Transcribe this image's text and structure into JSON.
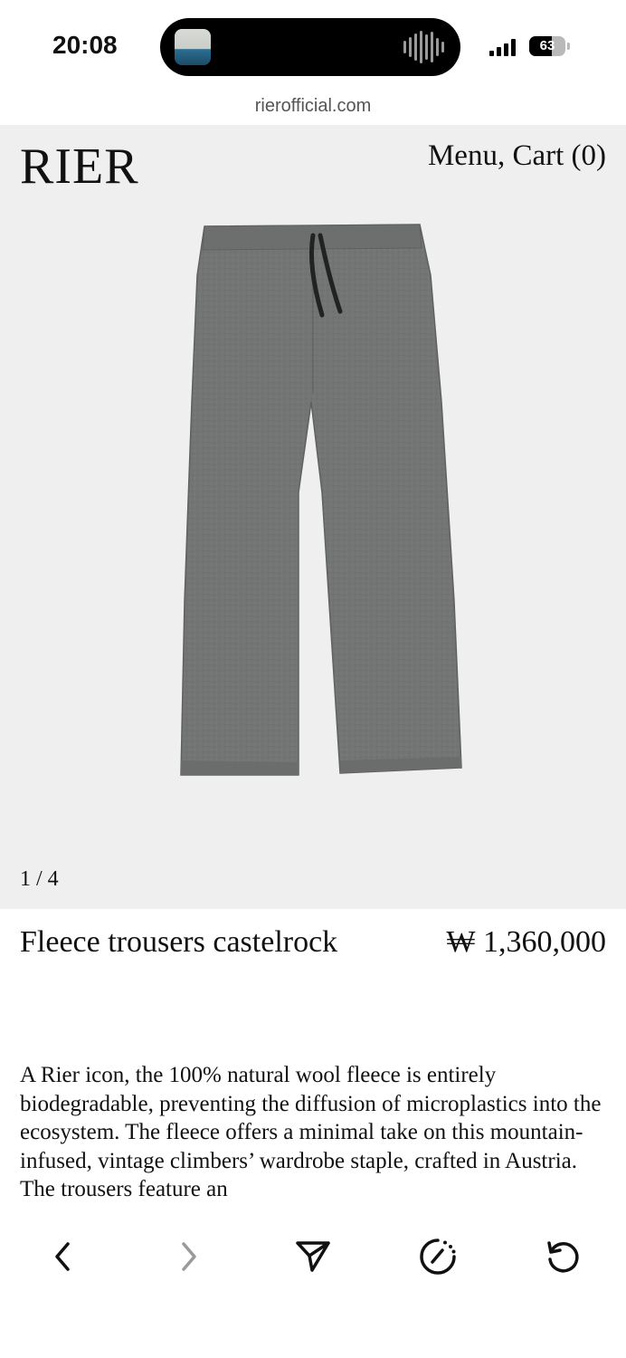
{
  "status_bar": {
    "time": "20:08",
    "battery_level": 63,
    "battery_text": "63",
    "signal_bars": 4
  },
  "browser": {
    "url": "rierofficial.com"
  },
  "site": {
    "logo": "RIER",
    "menu_cart": "Menu, Cart (0)"
  },
  "gallery": {
    "counter": "1 / 4",
    "image_icon": "grey-fleece-trousers-image"
  },
  "product": {
    "title": "Fleece trousers castelrock",
    "price": "₩ 1,360,000",
    "description": "A Rier icon, the 100% natural wool fleece is entirely biodegradable, preventing the diffusion of microplastics into the ecosystem. The fleece offers a minimal take on this mountain-infused, vintage climbers’ wardrobe staple, crafted in Austria. The trousers feature an"
  },
  "toolbar": {
    "icons": [
      "back-icon",
      "forward-icon",
      "share-icon",
      "speed-dial-icon",
      "reload-icon"
    ]
  },
  "colors": {
    "hero_bg": "#efefef",
    "trousers": "#737474",
    "text": "#111111"
  }
}
